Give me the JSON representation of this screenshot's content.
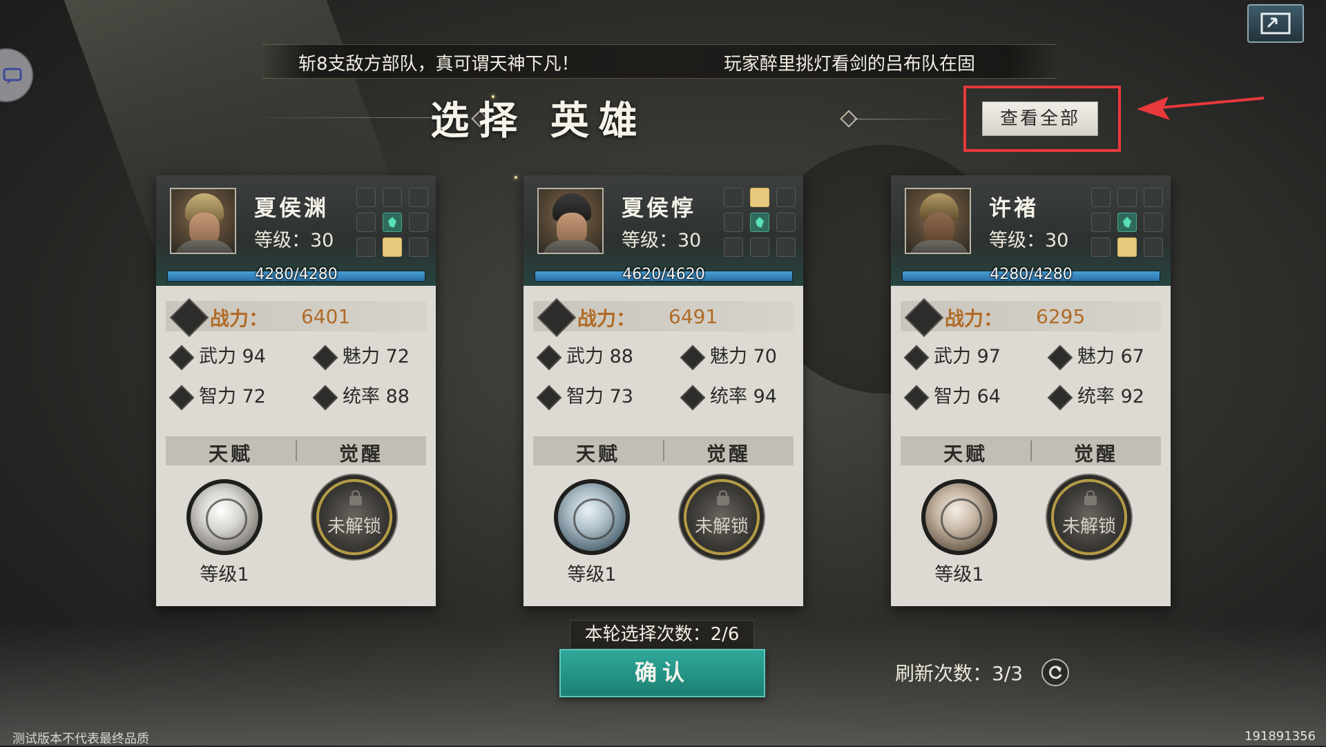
{
  "ticker": {
    "left_text": "斩8支敌方部队，真可谓天神下凡！",
    "right_text": "玩家醉里挑灯看剑的吕布队在固"
  },
  "title": "选择 英雄",
  "view_all_button": "查看全部",
  "heroes": [
    {
      "name": "夏侯渊",
      "level_text": "等级：30",
      "hp_text": "4280/4280",
      "hp_fraction": 1.0,
      "power_label": "战力：",
      "power_value": "6401",
      "stats": [
        {
          "label": "武力",
          "value": "94"
        },
        {
          "label": "魅力",
          "value": "72"
        },
        {
          "label": "智力",
          "value": "72"
        },
        {
          "label": "统率",
          "value": "88"
        }
      ],
      "tabs": [
        "天赋",
        "觉醒"
      ],
      "talent_level": "等级1",
      "awaken_status": "未解锁",
      "equip_slots": [
        "empty",
        "empty",
        "empty",
        "empty",
        "green",
        "empty",
        "empty",
        "gold",
        "empty"
      ]
    },
    {
      "name": "夏侯惇",
      "level_text": "等级：30",
      "hp_text": "4620/4620",
      "hp_fraction": 1.0,
      "power_label": "战力：",
      "power_value": "6491",
      "stats": [
        {
          "label": "武力",
          "value": "88"
        },
        {
          "label": "魅力",
          "value": "70"
        },
        {
          "label": "智力",
          "value": "73"
        },
        {
          "label": "统率",
          "value": "94"
        }
      ],
      "tabs": [
        "天赋",
        "觉醒"
      ],
      "talent_level": "等级1",
      "awaken_status": "未解锁",
      "equip_slots": [
        "empty",
        "gold",
        "empty",
        "empty",
        "green",
        "empty",
        "empty",
        "empty",
        "empty"
      ]
    },
    {
      "name": "许褚",
      "level_text": "等级：30",
      "hp_text": "4280/4280",
      "hp_fraction": 1.0,
      "power_label": "战力：",
      "power_value": "6295",
      "stats": [
        {
          "label": "武力",
          "value": "97"
        },
        {
          "label": "魅力",
          "value": "67"
        },
        {
          "label": "智力",
          "value": "64"
        },
        {
          "label": "统率",
          "value": "92"
        }
      ],
      "tabs": [
        "天赋",
        "觉醒"
      ],
      "talent_level": "等级1",
      "awaken_status": "未解锁",
      "equip_slots": [
        "empty",
        "empty",
        "empty",
        "empty",
        "green",
        "empty",
        "empty",
        "gold",
        "empty"
      ]
    }
  ],
  "selection_count": "本轮选择次数：2/6",
  "confirm_button": "确认",
  "refresh_count": "刷新次数：3/3",
  "footer_left": "测试版本不代表最终品质",
  "footer_right": "191891356",
  "colors": {
    "accent_teal": "#2fa99a",
    "power_orange": "#b06b26",
    "highlight_red": "#e8393c",
    "slot_gold": "#e8c87c"
  }
}
